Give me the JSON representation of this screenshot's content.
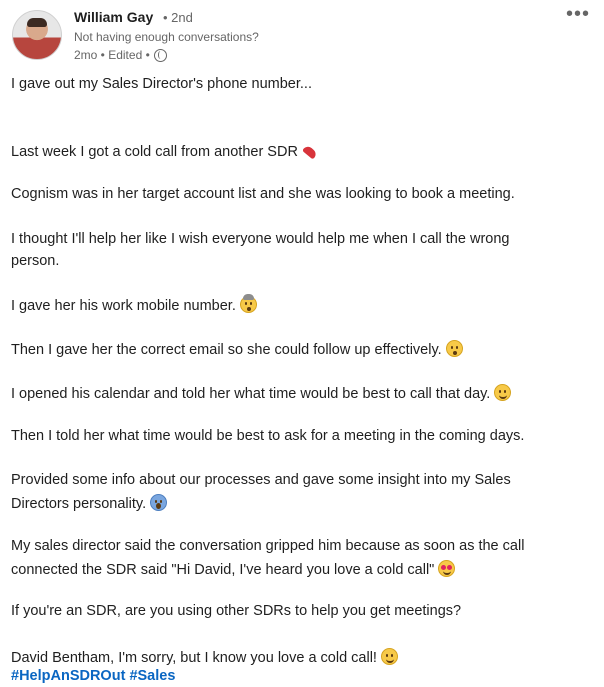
{
  "header": {
    "author": "William Gay",
    "degree": "• 2nd",
    "headline": "Not having enough conversations?",
    "meta": "2mo • Edited •",
    "more_label": "•••"
  },
  "body": {
    "l1": "I gave out my Sales Director's phone number...",
    "l2": "Last week I got a cold call from another SDR",
    "l3": "Cognism was in her target account list and she was looking to book a meeting.",
    "l4": "I thought I'll help her like I wish everyone would help me when I call the wrong",
    "l5": "person.",
    "l6": "I gave her his work mobile number.",
    "l7": "Then I gave her the correct email so she could follow up effectively.",
    "l8": "I opened his calendar and told her what time would be best to call that day.",
    "l9": "Then I told her what time would be best to ask for a meeting in the coming days.",
    "l10": "Provided some info about our processes and gave some insight into my Sales",
    "l11": "Directors personality.",
    "l12": "My sales director said the conversation gripped him because as soon as the call",
    "l13": "connected the SDR said \"Hi David, I've heard you love a cold call\"",
    "l14": "If you're an SDR, are you using other SDRs to help you get meetings?",
    "l15": "David Bentham, I'm sorry, but I know you love a cold call!",
    "hashtags": [
      "#HelpAnSDROut",
      "#Sales"
    ]
  },
  "icons": {
    "phone": "telephone-receiver-icon",
    "exploding": "exploding-head-icon",
    "surprised": "hushed-face-icon",
    "smile": "smiling-face-icon",
    "scream": "screaming-face-icon",
    "heart_eyes": "heart-eyes-icon",
    "wink": "winking-face-icon",
    "globe": "globe-icon"
  },
  "colors": {
    "hashtag": "#0a66c2",
    "text": "#1f1f1f",
    "muted": "#666666"
  }
}
